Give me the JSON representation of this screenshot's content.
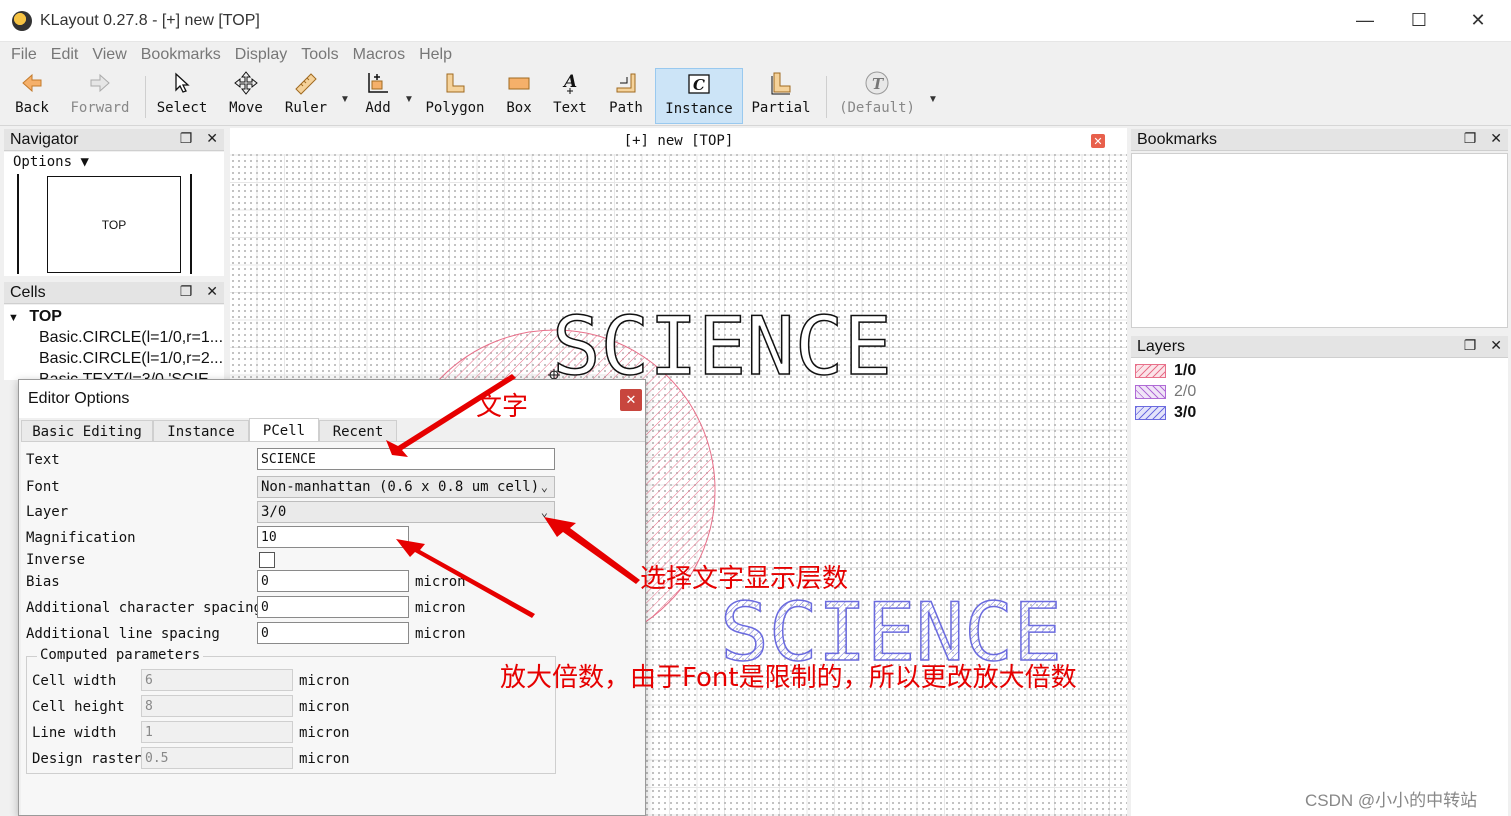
{
  "window": {
    "title": "KLayout 0.27.8 - [+] new [TOP]"
  },
  "menu": [
    "File",
    "Edit",
    "View",
    "Bookmarks",
    "Display",
    "Tools",
    "Macros",
    "Help"
  ],
  "toolbar": {
    "back": "Back",
    "forward": "Forward",
    "select": "Select",
    "move": "Move",
    "ruler": "Ruler",
    "add": "Add",
    "polygon": "Polygon",
    "box": "Box",
    "text": "Text",
    "path": "Path",
    "instance": "Instance",
    "partial": "Partial",
    "default": "(Default)"
  },
  "navigator": {
    "title": "Navigator",
    "options": "Options",
    "cell": "TOP"
  },
  "cells": {
    "title": "Cells",
    "root": "TOP",
    "children": [
      "Basic.CIRCLE(l=1/0,r=1...",
      "Basic.CIRCLE(l=1/0,r=2...",
      "Basic.TEXT(l=3/0,'SCIE..."
    ]
  },
  "canvas": {
    "title": "[+] new [TOP]",
    "text_shape": "SCIENCE"
  },
  "bookmarks": {
    "title": "Bookmarks"
  },
  "layers": {
    "title": "Layers",
    "items": [
      {
        "label": "1/0",
        "bold": true,
        "color": "#e8708a"
      },
      {
        "label": "2/0",
        "bold": false,
        "color": "#b06bd6"
      },
      {
        "label": "3/0",
        "bold": true,
        "color": "#6b6bdf"
      }
    ]
  },
  "dialog": {
    "title": "Editor Options",
    "tabs": [
      "Basic Editing",
      "Instance",
      "PCell",
      "Recent"
    ],
    "active_tab": "PCell",
    "fields": {
      "text_label": "Text",
      "text_value": "SCIENCE",
      "font_label": "Font",
      "font_value": "Non-manhattan (0.6 x 0.8 um cell)",
      "layer_label": "Layer",
      "layer_value": "3/0",
      "mag_label": "Magnification",
      "mag_value": "10",
      "inverse_label": "Inverse",
      "bias_label": "Bias",
      "bias_value": "0",
      "char_spacing_label": "Additional character spacing",
      "char_spacing_value": "0",
      "line_spacing_label": "Additional line spacing",
      "line_spacing_value": "0",
      "unit": "micron"
    },
    "computed": {
      "title": "Computed parameters",
      "cell_width_label": "Cell width",
      "cell_width_value": "6",
      "cell_height_label": "Cell height",
      "cell_height_value": "8",
      "line_width_label": "Line width",
      "line_width_value": "1",
      "design_raster_label": "Design raster",
      "design_raster_value": "0.5"
    }
  },
  "annotations": {
    "text_note": "文字",
    "layer_note": "选择文字显示层数",
    "mag_note": "放大倍数，由于Font是限制的，所以更改放大倍数"
  },
  "watermark": "CSDN @小小的中转站",
  "colors": {
    "accent": "#cce4f7",
    "annotation": "#e60000",
    "circle": "#e8708a",
    "text_layer": "#6b6bdf"
  }
}
